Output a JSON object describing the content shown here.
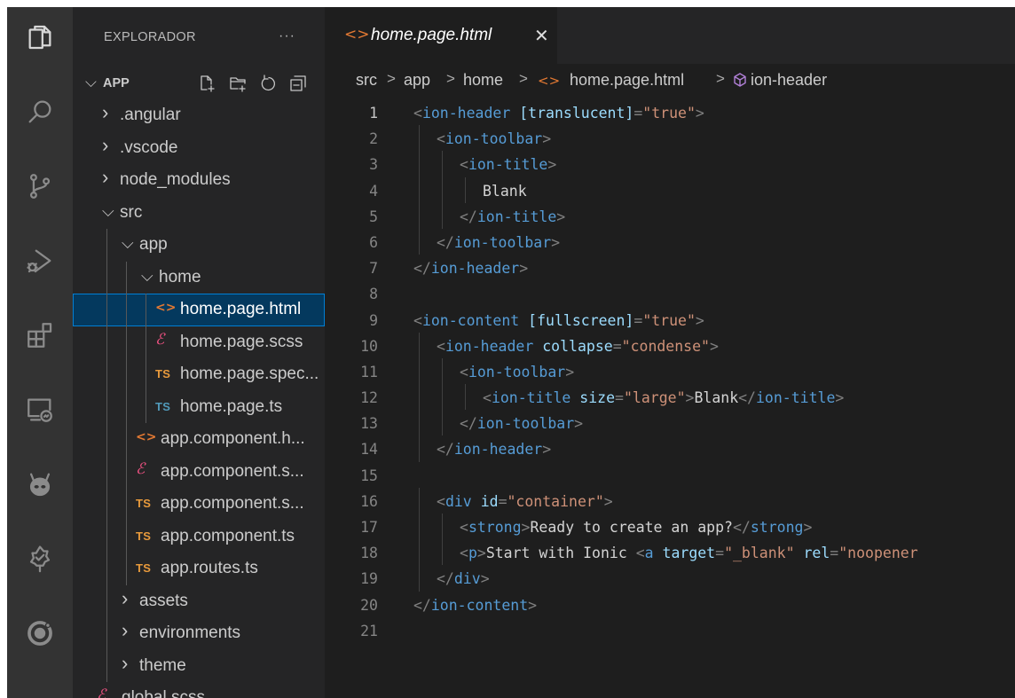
{
  "activity_bar": {
    "items": [
      {
        "icon": "explorer-icon",
        "active": true
      },
      {
        "icon": "search-icon"
      },
      {
        "icon": "source-control-icon"
      },
      {
        "icon": "run-debug-icon"
      },
      {
        "icon": "extensions-icon"
      },
      {
        "icon": "remote-explorer-icon"
      },
      {
        "icon": "ionic-alien-icon"
      },
      {
        "icon": "tree-icon"
      },
      {
        "icon": "ionic-logo-icon"
      }
    ]
  },
  "sidebar": {
    "title": "EXPLORADOR",
    "more": "···",
    "root_label": "APP",
    "root_actions": [
      "new-file-icon",
      "new-folder-icon",
      "refresh-icon",
      "collapse-all-icon"
    ],
    "tree": [
      {
        "label": ".angular",
        "type": "folder",
        "expanded": false
      },
      {
        "label": ".vscode",
        "type": "folder",
        "expanded": false
      },
      {
        "label": "node_modules",
        "type": "folder",
        "expanded": false
      },
      {
        "label": "src",
        "type": "folder",
        "expanded": true
      },
      {
        "label": "app",
        "type": "folder",
        "expanded": true
      },
      {
        "label": "home",
        "type": "folder",
        "expanded": true
      },
      {
        "label": "home.page.html",
        "type": "html",
        "selected": true
      },
      {
        "label": "home.page.scss",
        "type": "scss"
      },
      {
        "label": "home.page.spec...",
        "type": "ts",
        "badge": "TS"
      },
      {
        "label": "home.page.ts",
        "type": "ts",
        "badge": "TS"
      },
      {
        "label": "app.component.h...",
        "type": "html"
      },
      {
        "label": "app.component.s...",
        "type": "scss"
      },
      {
        "label": "app.component.s...",
        "type": "ts",
        "badge": "TS"
      },
      {
        "label": "app.component.ts",
        "type": "ts",
        "badge": "TS"
      },
      {
        "label": "app.routes.ts",
        "type": "ts",
        "badge": "TS"
      },
      {
        "label": "assets",
        "type": "folder",
        "expanded": false
      },
      {
        "label": "environments",
        "type": "folder",
        "expanded": false
      },
      {
        "label": "theme",
        "type": "folder",
        "expanded": false
      },
      {
        "label": "global.scss",
        "type": "scss"
      }
    ]
  },
  "editor": {
    "tab": {
      "label": "home.page.html",
      "close": "✕"
    },
    "breadcrumb": [
      "src",
      "app",
      "home",
      "home.page.html",
      "ion-header"
    ],
    "current_line": 1,
    "lines": [
      [
        [
          "br",
          "<"
        ],
        [
          "tag",
          "ion-header"
        ],
        [
          "tx",
          " "
        ],
        [
          "at",
          "[translucent]"
        ],
        [
          "br",
          "="
        ],
        [
          "st",
          "\"true\""
        ],
        [
          "br",
          ">"
        ]
      ],
      [
        [
          "br",
          "<"
        ],
        [
          "tag",
          "ion-toolbar"
        ],
        [
          "br",
          ">"
        ]
      ],
      [
        [
          "br",
          "<"
        ],
        [
          "tag",
          "ion-title"
        ],
        [
          "br",
          ">"
        ]
      ],
      [
        [
          "tx",
          "Blank"
        ]
      ],
      [
        [
          "br",
          "</"
        ],
        [
          "tag",
          "ion-title"
        ],
        [
          "br",
          ">"
        ]
      ],
      [
        [
          "br",
          "</"
        ],
        [
          "tag",
          "ion-toolbar"
        ],
        [
          "br",
          ">"
        ]
      ],
      [
        [
          "br",
          "</"
        ],
        [
          "tag",
          "ion-header"
        ],
        [
          "br",
          ">"
        ]
      ],
      [],
      [
        [
          "br",
          "<"
        ],
        [
          "tag",
          "ion-content"
        ],
        [
          "tx",
          " "
        ],
        [
          "at",
          "[fullscreen]"
        ],
        [
          "br",
          "="
        ],
        [
          "st",
          "\"true\""
        ],
        [
          "br",
          ">"
        ]
      ],
      [
        [
          "br",
          "<"
        ],
        [
          "tag",
          "ion-header"
        ],
        [
          "tx",
          " "
        ],
        [
          "at",
          "collapse"
        ],
        [
          "br",
          "="
        ],
        [
          "st",
          "\"condense\""
        ],
        [
          "br",
          ">"
        ]
      ],
      [
        [
          "br",
          "<"
        ],
        [
          "tag",
          "ion-toolbar"
        ],
        [
          "br",
          ">"
        ]
      ],
      [
        [
          "br",
          "<"
        ],
        [
          "tag",
          "ion-title"
        ],
        [
          "tx",
          " "
        ],
        [
          "at",
          "size"
        ],
        [
          "br",
          "="
        ],
        [
          "st",
          "\"large\""
        ],
        [
          "br",
          ">"
        ],
        [
          "tx",
          "Blank"
        ],
        [
          "br",
          "</"
        ],
        [
          "tag",
          "ion-title"
        ],
        [
          "br",
          ">"
        ]
      ],
      [
        [
          "br",
          "</"
        ],
        [
          "tag",
          "ion-toolbar"
        ],
        [
          "br",
          ">"
        ]
      ],
      [
        [
          "br",
          "</"
        ],
        [
          "tag",
          "ion-header"
        ],
        [
          "br",
          ">"
        ]
      ],
      [],
      [
        [
          "br",
          "<"
        ],
        [
          "tag",
          "div"
        ],
        [
          "tx",
          " "
        ],
        [
          "at",
          "id"
        ],
        [
          "br",
          "="
        ],
        [
          "st",
          "\"container\""
        ],
        [
          "br",
          ">"
        ]
      ],
      [
        [
          "br",
          "<"
        ],
        [
          "tag",
          "strong"
        ],
        [
          "br",
          ">"
        ],
        [
          "tx",
          "Ready to create an app?"
        ],
        [
          "br",
          "</"
        ],
        [
          "tag",
          "strong"
        ],
        [
          "br",
          ">"
        ]
      ],
      [
        [
          "br",
          "<"
        ],
        [
          "tag",
          "p"
        ],
        [
          "br",
          ">"
        ],
        [
          "tx",
          "Start with Ionic "
        ],
        [
          "br",
          "<"
        ],
        [
          "tag",
          "a"
        ],
        [
          "tx",
          " "
        ],
        [
          "at",
          "target"
        ],
        [
          "br",
          "="
        ],
        [
          "st",
          "\"_blank\""
        ],
        [
          "tx",
          " "
        ],
        [
          "at",
          "rel"
        ],
        [
          "br",
          "="
        ],
        [
          "st",
          "\"noopener"
        ]
      ],
      [
        [
          "br",
          "</"
        ],
        [
          "tag",
          "div"
        ],
        [
          "br",
          ">"
        ]
      ],
      [
        [
          "br",
          "</"
        ],
        [
          "tag",
          "ion-content"
        ],
        [
          "br",
          ">"
        ]
      ],
      []
    ]
  }
}
